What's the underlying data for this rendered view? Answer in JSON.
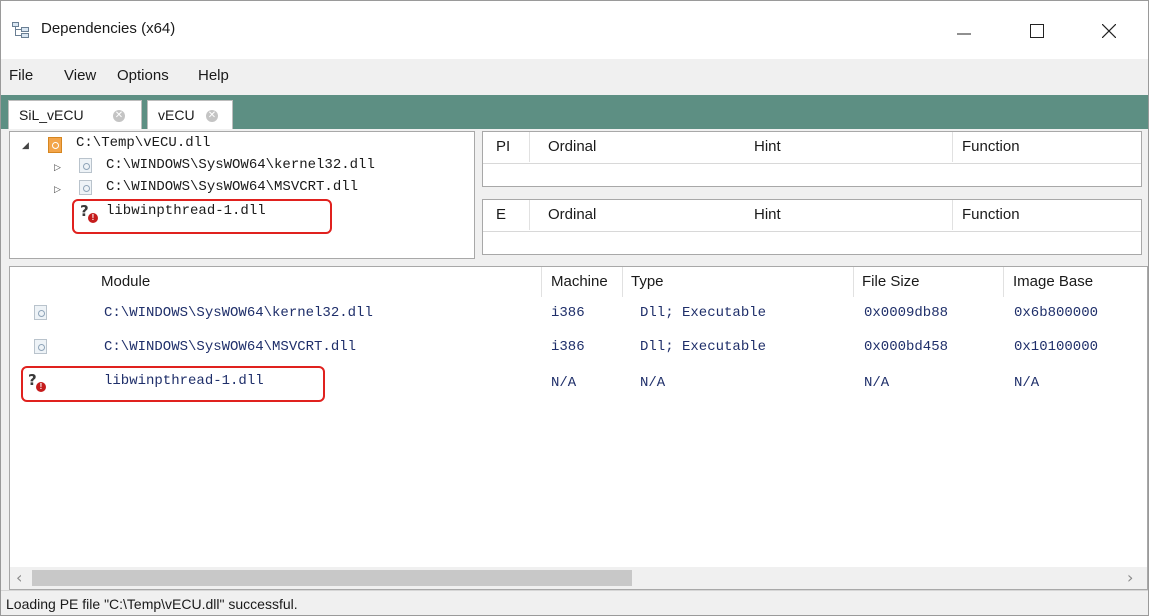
{
  "window": {
    "title": "Dependencies (x64)",
    "icons": {
      "app": "dependency-tree-icon",
      "minimize": "minimize-icon",
      "maximize": "maximize-icon",
      "close": "close-icon"
    }
  },
  "menu": {
    "items": [
      "File",
      "View",
      "Options",
      "Help"
    ]
  },
  "tabs": [
    {
      "label": "SiL_vECU",
      "close_icon": "tab-close-icon"
    },
    {
      "label": "vECU",
      "close_icon": "tab-close-icon",
      "active": true
    }
  ],
  "tree": {
    "root": {
      "path": "C:\\Temp\\vECU.dll",
      "icon": "dll-file-icon"
    },
    "children": [
      {
        "path": "C:\\WINDOWS\\SysWOW64\\kernel32.dll",
        "icon": "dll-file-icon"
      },
      {
        "path": "C:\\WINDOWS\\SysWOW64\\MSVCRT.dll",
        "icon": "dll-file-icon"
      },
      {
        "path": "libwinpthread-1.dll",
        "icon": "missing-module-icon"
      }
    ]
  },
  "imports_table": {
    "columns": [
      "PI",
      "Ordinal",
      "Hint",
      "Function"
    ]
  },
  "exports_table": {
    "columns": [
      "E",
      "Ordinal",
      "Hint",
      "Function"
    ]
  },
  "modules": {
    "columns": [
      "Module",
      "Machine",
      "Type",
      "File Size",
      "Image Base"
    ],
    "rows": [
      {
        "icon": "dll-file-icon",
        "module": "C:\\WINDOWS\\SysWOW64\\kernel32.dll",
        "machine": "i386",
        "type": "Dll; Executable",
        "file_size": "0x0009db88",
        "image_base": "0x6b800000"
      },
      {
        "icon": "dll-file-icon",
        "module": "C:\\WINDOWS\\SysWOW64\\MSVCRT.dll",
        "machine": "i386",
        "type": "Dll; Executable",
        "file_size": "0x000bd458",
        "image_base": "0x10100000"
      },
      {
        "icon": "missing-module-icon",
        "module": "libwinpthread-1.dll",
        "machine": "N/A",
        "type": "N/A",
        "file_size": "N/A",
        "image_base": "N/A"
      }
    ]
  },
  "status": {
    "text": "Loading PE file \"C:\\Temp\\vECU.dll\" successful."
  },
  "colors": {
    "tab_strip": "#5d8f83",
    "highlight_border": "#e0211e",
    "module_text": "#1f2f6a"
  }
}
